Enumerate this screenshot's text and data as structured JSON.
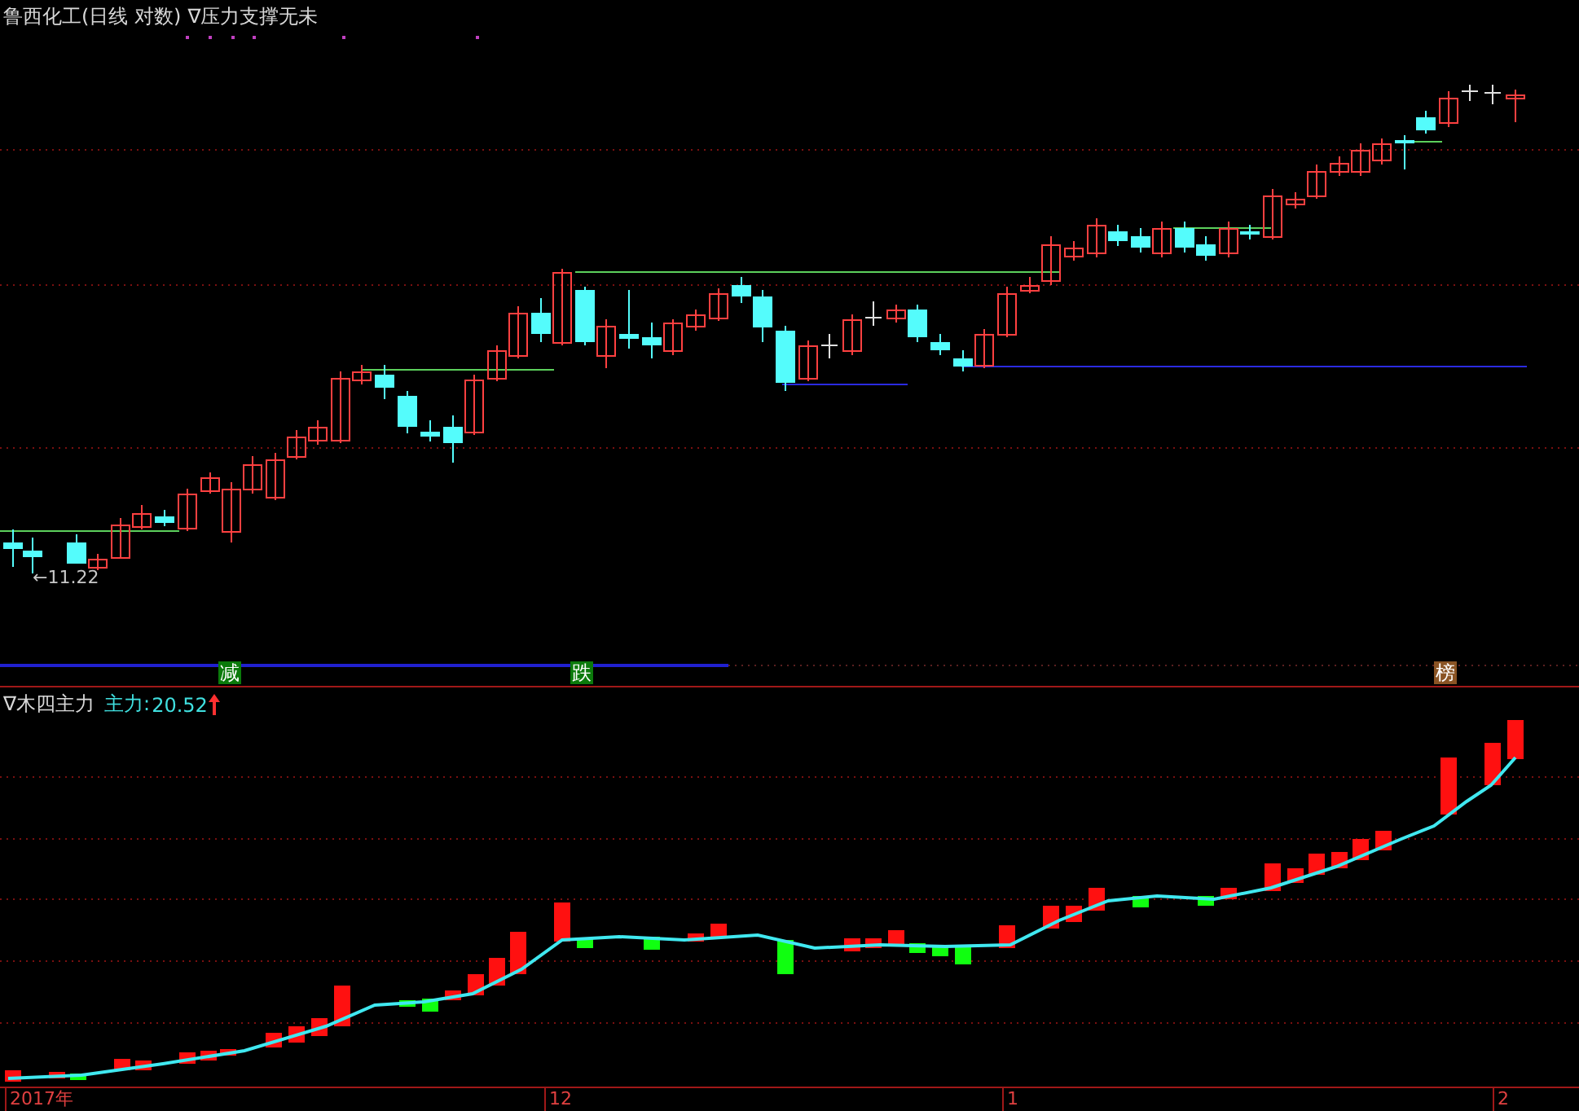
{
  "chart": {
    "title": "鲁西化工(日线 对数)",
    "indicator": "∇压力支撑无未",
    "price_label": "←11.22",
    "signals": [
      {
        "label": "减",
        "color": "#0b7a0b"
      },
      {
        "label": "跌",
        "color": "#0b7a0b"
      },
      {
        "label": "榜",
        "color": "#8a5424"
      }
    ]
  },
  "indicator_panel": {
    "name": "∇木四主力",
    "series_label": "主力:",
    "value": "20.52"
  },
  "date_axis": {
    "labels": [
      "2017年",
      "12",
      "1",
      "2"
    ]
  }
}
